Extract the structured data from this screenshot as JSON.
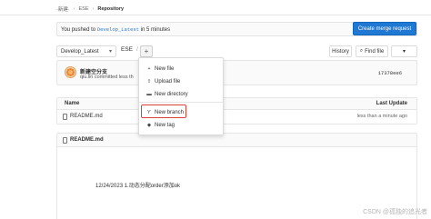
{
  "breadcrumb": {
    "root": "·新建·",
    "project": "ESE",
    "current": "Repository"
  },
  "push_banner": {
    "prefix": "You pushed to",
    "branch": "Develop_Latest",
    "suffix": "in 5 minutes"
  },
  "merge_button": "Create merge request",
  "toolbar": {
    "branch": "Develop_Latest",
    "path": "ESE",
    "separator": "/",
    "add": "+",
    "history": "History",
    "find_file": "Find file",
    "clone_arrow": "▾"
  },
  "commit": {
    "title": "新建空分支",
    "meta": "qiu.lin committed less th",
    "sha": "17378ee6"
  },
  "files": {
    "header_name": "Name",
    "header_update": "Last Update",
    "rows": [
      {
        "name": "README.md",
        "date": "less than a minute ago"
      }
    ]
  },
  "readme": {
    "title": "README.md",
    "content": "12/24/2023 1.动态分配order添加ok"
  },
  "dropdown": {
    "items": [
      {
        "label": "New file",
        "icon": "+"
      },
      {
        "label": "Upload file",
        "icon": "⇪"
      },
      {
        "label": "New directory",
        "icon": "▬"
      },
      {
        "label": "New branch",
        "icon": "Ƴ"
      },
      {
        "label": "New tag",
        "icon": "◆"
      }
    ]
  },
  "watermark": "CSDN @孤独的追光者",
  "colors": {
    "primary": "#1f78d1",
    "highlight": "#d9433a"
  }
}
